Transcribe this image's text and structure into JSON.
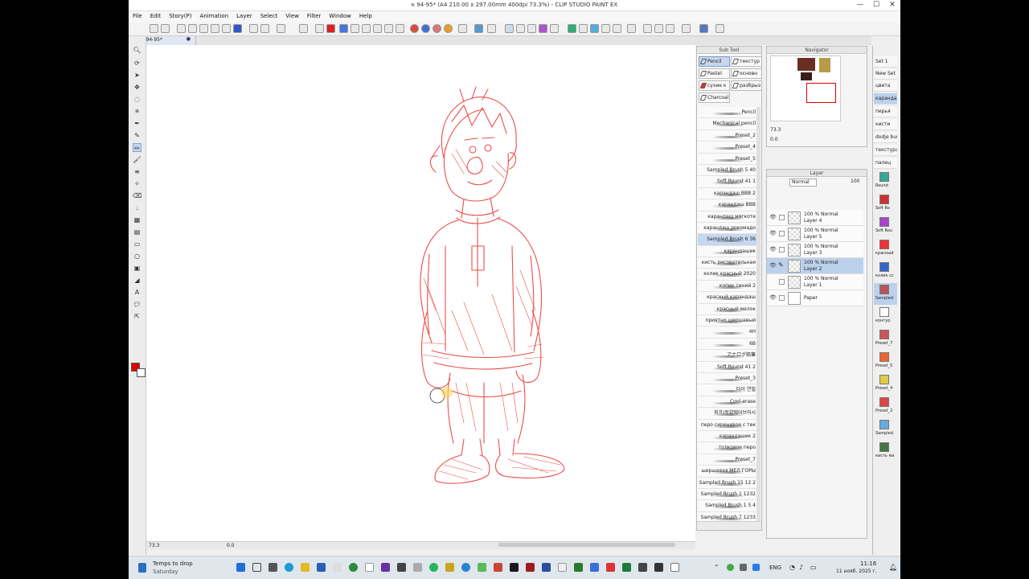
{
  "window": {
    "title": "к 94-95* (A4 210.00 x 297.00mm 400dpi 73.3%) - CLIP STUDIO PAINT EX",
    "minimize": "—",
    "restore": "☐",
    "close": "✕"
  },
  "menu": [
    "File",
    "Edit",
    "Story(P)",
    "Animation",
    "Layer",
    "Select",
    "View",
    "Filter",
    "Window",
    "Help"
  ],
  "tab": {
    "label": "к 94-95*",
    "dot": "●"
  },
  "canvas": {
    "zoom": "73.3",
    "angle": "0.0"
  },
  "subtool": {
    "title": "Sub Tool",
    "tabs": [
      "Pencil",
      "текстур",
      "Pastel",
      "основн",
      "сухие к",
      "разбрыз",
      "Charcoal"
    ],
    "selected_tab": "Pencil",
    "brushes": [
      "Pencil",
      "Mechanical pencil",
      "Preset_2",
      "Preset_4",
      "Preset_5",
      "Sampled Brush 5 40",
      "Soft Round 41 1",
      "карандаш BBB 2",
      "карандаш BBB",
      "карандаш мягкоте",
      "карандаш рокомадо",
      "Sampled Brush 6 36",
      "карандашик",
      "кисть рисовательная",
      "колик красный 2020",
      "копик синий 2",
      "красный карандаш",
      "красный мелок",
      "приятно шершавый",
      "4H",
      "6B",
      "アナログ鉛筆",
      "Soft Round 41 2",
      "Preset_3",
      "타이 연필",
      "Cool-erase",
      "피프/동양에어브러시",
      "перо сиреневое с тек",
      "карандашик 2",
      "толковое перо",
      "Preset_7",
      "шершавая МЕЛ ГОРЫ",
      "Sampled Brush 15 12 2",
      "Sampled Brush 1 1232",
      "Sampled Brush 1 5 4",
      "Sampled Brush 7 1233"
    ],
    "selected_brush": "Sampled Brush 6 36"
  },
  "navigator": {
    "title": "Navigator",
    "zoom": "73.3",
    "angle": "0.0"
  },
  "layer": {
    "title": "Layer",
    "blend_mode": "Normal",
    "opacity": "100",
    "layers": [
      {
        "opacity": "100 % Normal",
        "name": "Layer 4",
        "visible": true,
        "selected": false
      },
      {
        "opacity": "100 % Normal",
        "name": "Layer 5",
        "visible": true,
        "selected": false
      },
      {
        "opacity": "100 % Normal",
        "name": "Layer 3",
        "visible": true,
        "selected": false
      },
      {
        "opacity": "100 % Normal",
        "name": "Layer 2",
        "visible": true,
        "selected": true
      },
      {
        "opacity": "100 % Normal",
        "name": "Layer 1",
        "visible": false,
        "selected": false
      },
      {
        "opacity": "",
        "name": "Paper",
        "visible": true,
        "selected": false
      }
    ]
  },
  "brush_sets": {
    "tabs": [
      "Set 1",
      "New Set",
      "цвета",
      "карандаш",
      "перья",
      "кисти",
      "dodje burn",
      "текстура",
      "палец"
    ],
    "selected": "карандаш",
    "items": [
      "Round",
      "Soft Ro",
      "Soft Rou",
      "красный",
      "колик сс",
      "Sampled",
      "контур",
      "Preset_7",
      "Preset_5",
      "Preset_4",
      "Preset_2",
      "Sampled",
      "кисть ма"
    ]
  },
  "colors": {
    "main": "#e00000",
    "sub": "#ffffff",
    "sketch": "#e8302a",
    "highlight": "#bcd1ec"
  },
  "taskbar": {
    "weather_title": "Temps to drop",
    "weather_sub": "Saturday",
    "lang": "ENG",
    "time": "11:16",
    "date": "11 нояб. 2025 г."
  }
}
